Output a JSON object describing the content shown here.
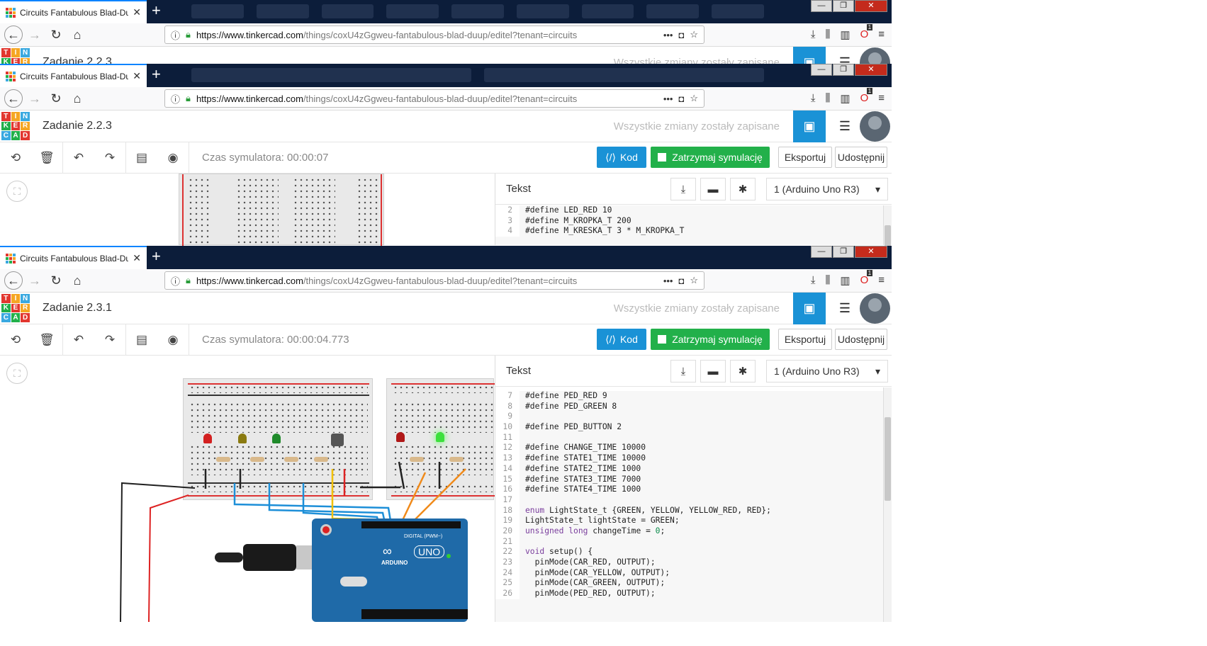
{
  "browser": {
    "tab_title": "Circuits Fantabulous Blad-Duu",
    "url_host": "https://www.tinkercad.com",
    "url_path": "/things/coxU4zGgweu-fantabulous-blad-duup/editel?tenant=circuits",
    "win_min": "—",
    "win_max": "❐",
    "win_close": "✕",
    "new_tab": "+",
    "notif_count": "1"
  },
  "windows": [
    {
      "project": "Zadanie 2.2.3",
      "sim_time": ""
    },
    {
      "project": "Zadanie 2.2.3",
      "sim_time": "Czas symulatora: 00:00:07"
    },
    {
      "project": "Zadanie 2.3.1",
      "sim_time": "Czas symulatora: 00:00:04.773"
    }
  ],
  "tinkercad": {
    "saved": "Wszystkie zmiany zostały zapisane",
    "kod": "Kod",
    "stop": "Zatrzymaj symulację",
    "export": "Eksportuj",
    "share": "Udostępnij",
    "logo": [
      "T",
      "I",
      "N",
      "K",
      "E",
      "R",
      "C",
      "A",
      "D"
    ],
    "logo_colors": [
      "#e2372f",
      "#f5a623",
      "#3aa9e0",
      "#22b04a",
      "#e2372f",
      "#f5a623",
      "#3aa9e0",
      "#22b04a",
      "#e2372f"
    ]
  },
  "code_panel": {
    "label": "Tekst",
    "device": "1 (Arduino Uno R3)"
  },
  "code_top": [
    {
      "n": "2",
      "t": "#define LED_RED 10"
    },
    {
      "n": "3",
      "t": "#define M_KROPKA_T 200"
    },
    {
      "n": "4",
      "t": "#define M_KRESKA_T 3 * M_KROPKA_T"
    }
  ],
  "code_bottom": [
    {
      "n": "7",
      "t": "#define PED_RED 9"
    },
    {
      "n": "8",
      "t": "#define PED_GREEN 8"
    },
    {
      "n": "9",
      "t": ""
    },
    {
      "n": "10",
      "t": "#define PED_BUTTON 2"
    },
    {
      "n": "11",
      "t": ""
    },
    {
      "n": "12",
      "t": "#define CHANGE_TIME 10000"
    },
    {
      "n": "13",
      "t": "#define STATE1_TIME 10000"
    },
    {
      "n": "14",
      "t": "#define STATE2_TIME 1000"
    },
    {
      "n": "15",
      "t": "#define STATE3_TIME 7000"
    },
    {
      "n": "16",
      "t": "#define STATE4_TIME 1000"
    },
    {
      "n": "17",
      "t": ""
    },
    {
      "n": "18",
      "t": "enum LightState_t {GREEN, YELLOW, YELLOW_RED, RED};"
    },
    {
      "n": "19",
      "t": "LightState_t lightState = GREEN;"
    },
    {
      "n": "20",
      "t": "unsigned long changeTime = 0;"
    },
    {
      "n": "21",
      "t": ""
    },
    {
      "n": "22",
      "t": "void setup() {"
    },
    {
      "n": "23",
      "t": "  pinMode(CAR_RED, OUTPUT);"
    },
    {
      "n": "24",
      "t": "  pinMode(CAR_YELLOW, OUTPUT);"
    },
    {
      "n": "25",
      "t": "  pinMode(CAR_GREEN, OUTPUT);"
    },
    {
      "n": "26",
      "t": "  pinMode(PED_RED, OUTPUT);"
    }
  ],
  "arduino": {
    "brand": "ARDUINO",
    "model": "UNO",
    "digital": "DIGITAL (PWM~)"
  }
}
